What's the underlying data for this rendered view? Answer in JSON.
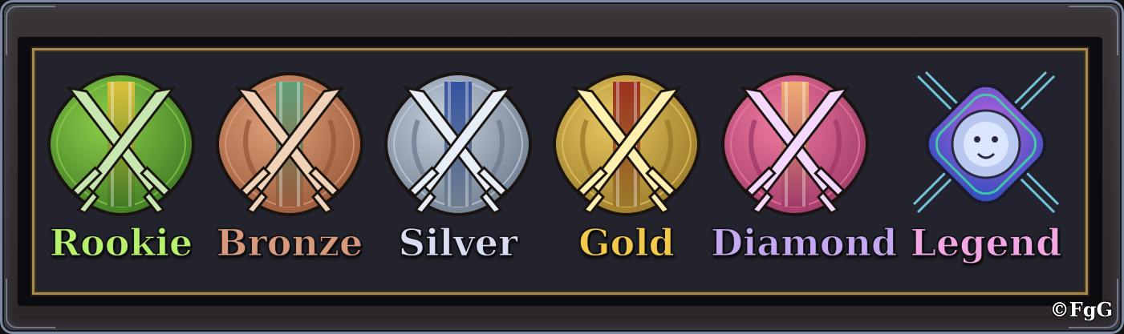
{
  "tiers": [
    {
      "name": "Rookie",
      "text_color": "#b7f06a",
      "icon": "rookie-crossed-swords-emblem",
      "base": "#3f7a24",
      "light": "#8ccf4a",
      "stripe": "#e2c23a",
      "blade": "#c8e6b0"
    },
    {
      "name": "Bronze",
      "text_color": "#d79a7c",
      "icon": "bronze-crossed-swords-emblem",
      "base": "#9a5a3a",
      "light": "#e0a07a",
      "stripe": "#5aa27a",
      "blade": "#f0d2b8"
    },
    {
      "name": "Silver",
      "text_color": "#d8ddf2",
      "icon": "silver-crossed-swords-emblem",
      "base": "#6f7d8f",
      "light": "#c5d0dc",
      "stripe": "#2f4f9e",
      "blade": "#e8eef8"
    },
    {
      "name": "Gold",
      "text_color": "#f2c94a",
      "icon": "gold-crossed-swords-emblem",
      "base": "#9a7a2a",
      "light": "#e8c860",
      "stripe": "#9a2a1e",
      "blade": "#fff0b0"
    },
    {
      "name": "Diamond",
      "text_color": "#c5a8f2",
      "icon": "diamond-crossed-swords-emblem",
      "base": "#a03a6a",
      "light": "#f07aa0",
      "stripe": "#f0b070",
      "blade": "#f4d8ff"
    },
    {
      "name": "Legend",
      "text_color": "#f4a6e4",
      "icon": "legend-lion-emblem",
      "base": "#3a50c0",
      "light": "#c060e0",
      "stripe": "#40e0a0",
      "blade": "#d8e4ff"
    }
  ],
  "copyright": "©FgG"
}
